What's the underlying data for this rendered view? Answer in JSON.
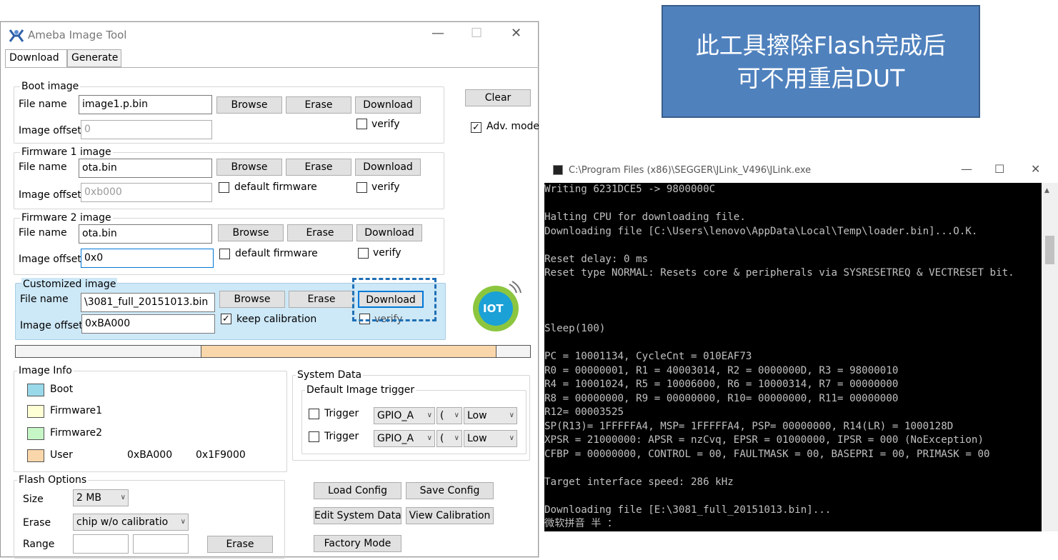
{
  "ameba": {
    "title": "Ameba Image Tool",
    "minimize": "—",
    "maximize": "☐",
    "close": "✕",
    "tabs": [
      "Download",
      "Generate"
    ],
    "boot": {
      "title": "Boot image",
      "file_label": "File name",
      "file_value": "image1.p.bin",
      "offset_label": "Image offset",
      "offset_value": "0",
      "browse": "Browse",
      "erase": "Erase",
      "download": "Download",
      "verify": "verify"
    },
    "fw1": {
      "title": "Firmware 1 image",
      "file_label": "File name",
      "file_value": "ota.bin",
      "offset_label": "Image offset",
      "offset_value": "0xb000",
      "browse": "Browse",
      "erase": "Erase",
      "download": "Download",
      "default_fw": "default firmware",
      "verify": "verify"
    },
    "fw2": {
      "title": "Firmware 2 image",
      "file_label": "File name",
      "file_value": "ota.bin",
      "offset_label": "Image offset",
      "offset_value": "0x0",
      "browse": "Browse",
      "erase": "Erase",
      "download": "Download",
      "default_fw": "default firmware",
      "verify": "verify"
    },
    "custom": {
      "title": "Customized image",
      "file_label": "File name",
      "file_value": "\\3081_full_20151013.bin",
      "offset_label": "Image offset",
      "offset_value": "0xBA000",
      "browse": "Browse",
      "erase": "Erase",
      "download": "Download",
      "keep_cal": "keep calibration",
      "verify": "verify"
    },
    "clear": "Clear",
    "adv_mode": "Adv. mode",
    "iot_logo": "IOT",
    "progress": 0.575,
    "image_info": {
      "title": "Image Info",
      "items": [
        "Boot",
        "Firmware1",
        "Firmware2",
        "User"
      ],
      "colors": [
        "#99d9ea",
        "#ffffd6",
        "#c6f5c6",
        "#fad7aa"
      ],
      "user_start": "0xBA000",
      "user_end": "0x1F9000"
    },
    "system_data": {
      "title": "System Data",
      "trigger_title": "Default Image trigger",
      "trigger_label": "Trigger",
      "gpio": "GPIO_A",
      "pin": "(",
      "level": "Low"
    },
    "flash": {
      "title": "Flash Options",
      "size_label": "Size",
      "size_value": "2 MB",
      "erase_label": "Erase",
      "erase_value": "chip w/o calibratio",
      "range_label": "Range",
      "erase_btn": "Erase"
    },
    "buttons": {
      "load_config": "Load Config",
      "save_config": "Save Config",
      "edit_system": "Edit System Data",
      "view_cal": "View Calibration",
      "factory": "Factory Mode"
    }
  },
  "callout": {
    "line1": "此工具擦除Flash完成后",
    "line2": "可不用重启DUT"
  },
  "jlink": {
    "title": "C:\\Program Files (x86)\\SEGGER\\JLink_V496\\JLink.exe",
    "minimize": "—",
    "maximize": "☐",
    "close": "✕",
    "console": "Writing 6231DCE5 -> 9800000C\n\nHalting CPU for downloading file.\nDownloading file [C:\\Users\\lenovo\\AppData\\Local\\Temp\\loader.bin]...O.K.\n\nReset delay: 0 ms\nReset type NORMAL: Resets core & peripherals via SYSRESETREQ & VECTRESET bit.\n\n\n\nSleep(100)\n\nPC = 10001134, CycleCnt = 010EAF73\nR0 = 00000001, R1 = 40003014, R2 = 0000000D, R3 = 98000010\nR4 = 10001024, R5 = 10006000, R6 = 10000314, R7 = 00000000\nR8 = 00000000, R9 = 00000000, R10= 00000000, R11= 00000000\nR12= 00003525\nSP(R13)= 1FFFFFA4, MSP= 1FFFFFA4, PSP= 00000000, R14(LR) = 1000128D\nXPSR = 21000000: APSR = nzCvq, EPSR = 01000000, IPSR = 000 (NoException)\nCFBP = 00000000, CONTROL = 00, FAULTMASK = 00, BASEPRI = 00, PRIMASK = 00\n\nTarget interface speed: 286 kHz\n\nDownloading file [E:\\3081_full_20151013.bin]...\n微软拼音 半 ："
  }
}
